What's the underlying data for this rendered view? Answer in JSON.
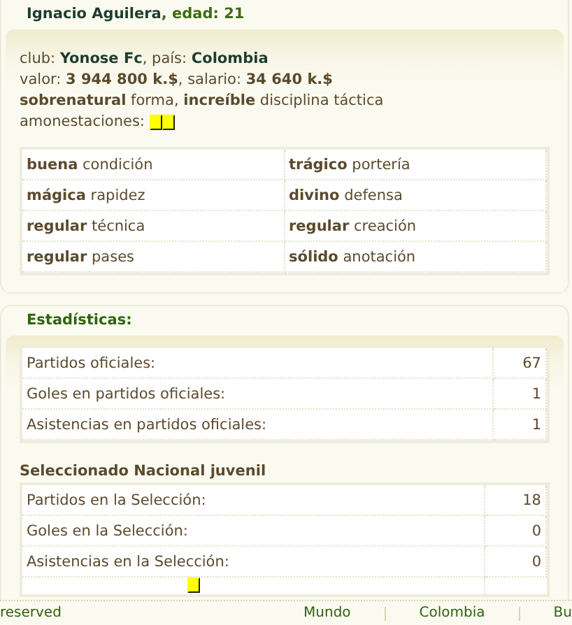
{
  "player": {
    "name": "Ignacio Aguilera",
    "age_label": ", edad: 21"
  },
  "info": [
    {
      "kind": "club",
      "text": "club: **Yonose Fc**, país: **Colombia**"
    },
    {
      "kind": "plain",
      "text": "valor: **3 944 800 k.$**, salario: **34 640 k.$**"
    },
    {
      "kind": "plain",
      "text": "**sobrenatural** forma, **increíble** disciplina táctica"
    }
  ],
  "cautions": {
    "label": "amonestaciones:",
    "cards": [
      {
        "kind": "yellow"
      },
      {
        "kind": "yellow"
      }
    ]
  },
  "skills": [
    {
      "grade": "buena",
      "name": "condición"
    },
    {
      "grade": "trágico",
      "name": "portería"
    },
    {
      "grade": "mágica",
      "name": "rapidez"
    },
    {
      "grade": "divino",
      "name": "defensa"
    },
    {
      "grade": "regular",
      "name": "técnica"
    },
    {
      "grade": "regular",
      "name": "creación"
    },
    {
      "grade": "regular",
      "name": "pases"
    },
    {
      "grade": "sólido",
      "name": "anotación"
    }
  ],
  "stats": {
    "title": "Estadísticas:",
    "rows": [
      {
        "label": "Partidos oficiales:",
        "value": "67"
      },
      {
        "label": "Goles en partidos oficiales:",
        "value": "1"
      },
      {
        "label": "Asistencias en partidos oficiales:",
        "value": "1"
      }
    ]
  },
  "national": {
    "title": "Seleccionado Nacional juvenil",
    "rows": [
      {
        "label": "Partidos en la Selección:",
        "value": "18"
      },
      {
        "label": "Goles en la Selección:",
        "value": "0"
      },
      {
        "label": "Asistencias en la Selección:",
        "value": "0"
      }
    ],
    "partial_cards": [
      {
        "kind": "yellow"
      }
    ]
  },
  "footer": {
    "left": "reserved",
    "links": [
      "Mundo",
      "Colombia",
      "Bu"
    ]
  }
}
